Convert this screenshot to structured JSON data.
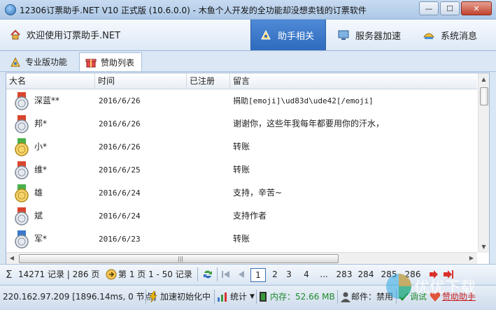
{
  "window": {
    "title": "12306订票助手.NET V10 正式版 (10.6.0.0) - 木鱼个人开发的全功能却没想卖钱的订票软件",
    "min_glyph": "—",
    "max_glyph": "☐",
    "close_glyph": "✕"
  },
  "header": {
    "welcome": "欢迎使用订票助手.NET",
    "nav": [
      {
        "label": "助手相关",
        "active": true,
        "icon": "assistant-icon"
      },
      {
        "label": "服务器加速",
        "active": false,
        "icon": "monitor-icon"
      },
      {
        "label": "系统消息",
        "active": false,
        "icon": "message-icon"
      }
    ]
  },
  "subtabs": [
    {
      "label": "专业版功能",
      "active": false,
      "icon": "pro-icon"
    },
    {
      "label": "赞助列表",
      "active": true,
      "icon": "gift-icon"
    }
  ],
  "table": {
    "columns": [
      "大名",
      "时间",
      "已注册",
      "留言"
    ],
    "rows": [
      {
        "name": "深蓝**",
        "date": "2016/6/26",
        "registered": "",
        "message": "捐助[emoji]\\ud83d\\ude42[/emoji]",
        "medal": "silver"
      },
      {
        "name": "邦*",
        "date": "2016/6/26",
        "registered": "",
        "message": "谢谢你，这些年我每年都要用你的汗水，",
        "medal": "silver"
      },
      {
        "name": "小*",
        "date": "2016/6/26",
        "registered": "",
        "message": "转账",
        "medal": "gold"
      },
      {
        "name": "维*",
        "date": "2016/6/25",
        "registered": "",
        "message": "转账",
        "medal": "silver"
      },
      {
        "name": "雄",
        "date": "2016/6/24",
        "registered": "",
        "message": "支持，辛苦~",
        "medal": "gold"
      },
      {
        "name": "斌",
        "date": "2016/6/24",
        "registered": "",
        "message": "支持作者",
        "medal": "silver"
      },
      {
        "name": "军*",
        "date": "2016/6/23",
        "registered": "",
        "message": "转账",
        "medal": "silver"
      }
    ]
  },
  "pager": {
    "records": "14271 记录 | 286 页",
    "page_info": "第 1 页 1 - 50 记录",
    "pages": [
      "1",
      "2",
      "3",
      "4",
      "...",
      "283",
      "284",
      "285",
      "286"
    ],
    "current_page": "1"
  },
  "statusbar": {
    "ip": "220.162.97.209 [1896.14ms, 0 节点]",
    "accel": "加速初始化中",
    "stats": "统计",
    "memory": "内存：52.66 MB",
    "mail": "邮件：禁用",
    "debug": "调试",
    "sponsor": "赞助助手"
  },
  "watermark": "优优下载",
  "colors": {
    "nav_active": "#3a78c9",
    "memory_text": "#1e8a2c",
    "sponsor_text": "#c62020"
  }
}
